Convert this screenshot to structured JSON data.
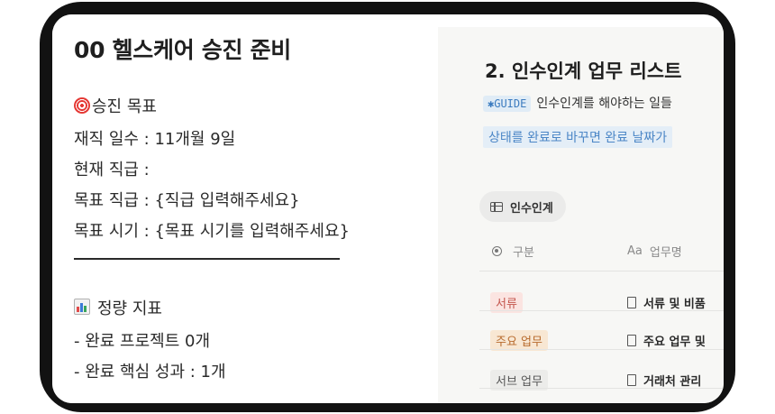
{
  "left": {
    "title": "00 헬스케어 승진 준비",
    "section1_label": "승진 목표",
    "line_days": "재직 일수 : 11개월 9일",
    "line_current": "현재 직급 :",
    "line_target_rank": "목표 직급 : {직급 입력해주세요}",
    "line_target_time": "목표 시기 : {목표 시기를 입력해주세요}",
    "section2_label": "정량 지표",
    "line_projects": "- 완료 프로젝트 0개",
    "line_results": "- 완료 핵심 성과 : 1개"
  },
  "right": {
    "title": "2. 인수인계 업무 리스트",
    "guide_badge": "✱GUIDE",
    "guide_text": "인수인계를 해야하는 일들",
    "hint_text": "상태를 완료로 바꾸면 완료 날짜가",
    "view_tab": "인수인계",
    "col1": "구분",
    "col2": "업무명",
    "col2_prefix": "Aa",
    "rows": [
      {
        "tag": "서류",
        "name": "서류 및 비품"
      },
      {
        "tag": "주요 업무",
        "name": "주요 업무 및"
      },
      {
        "tag": "서브 업무",
        "name": "거래처 관리"
      }
    ]
  },
  "colors": {
    "tag_docs_bg": "#fbe4e1",
    "tag_docs_fg": "#c4554d",
    "tag_main_bg": "#f8e7d3",
    "tag_main_fg": "#b76a2c",
    "tag_sub_bg": "#ececea",
    "tag_sub_fg": "#555555"
  }
}
